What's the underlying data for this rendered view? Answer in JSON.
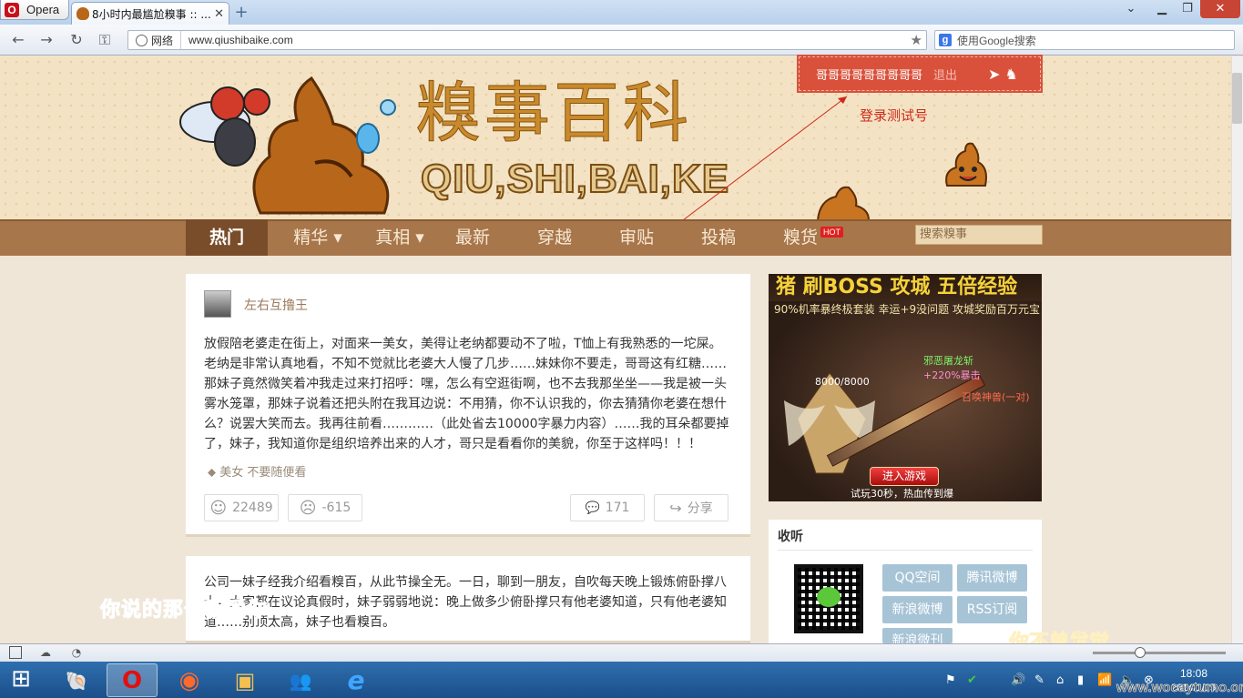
{
  "browser": {
    "menu_label": "Opera",
    "tab_title": "8小时内最尴尬糗事 :: ...",
    "tab_close": "✕",
    "new_tab": "+",
    "window_controls": {
      "minimize": "▁",
      "maximize": "❐",
      "close": "✕",
      "tabs_menu": "⌄"
    },
    "nav": {
      "back": "←",
      "forward": "→",
      "reload": "↻",
      "key": "⚿"
    },
    "address_zone": "网络",
    "url": "www.qiushibaike.com",
    "bookmark_star": "★",
    "search_placeholder": "使用Google搜索",
    "search_engine": "g"
  },
  "site": {
    "title_cn": "糗事百科",
    "title_en": "QIU,SHI,BAI,KE",
    "username": "哥哥哥哥哥哥哥哥哥",
    "logout": "退出",
    "user_arrows": "➤ ♞",
    "annotation": "登录测试号",
    "nav": [
      {
        "label": "热门",
        "active": true
      },
      {
        "label": "精华 ▾",
        "active": false
      },
      {
        "label": "真相 ▾",
        "active": false
      },
      {
        "label": "最新",
        "active": false
      },
      {
        "label": "穿越",
        "active": false
      },
      {
        "label": "审贴",
        "active": false
      },
      {
        "label": "投稿",
        "active": false
      },
      {
        "label": "糗货",
        "active": false
      }
    ],
    "hot_badge": "HOT",
    "search_placeholder": "搜索糗事"
  },
  "posts": [
    {
      "author": "左右互撸王",
      "text": "放假陪老婆走在街上，对面来一美女，美得让老纳都要动不了啦，T恤上有我熟悉的一坨屎。老纳是非常认真地看，不知不觉就比老婆大人慢了几步……妹妹你不要走，哥哥这有红糖……那妹子竟然微笑着冲我走过来打招呼：嘿，怎么有空逛街啊，也不去我那坐坐——我是被一头雾水笼罩，那妹子说着还把头附在我耳边说：不用猜，你不认识我的，你去猜猜你老婆在想什么？说罢大笑而去。我再往前看…………（此处省去10000字暴力内容）……我的耳朵都要掉了，妹子，我知道你是组织培养出来的人才，哥只是看看你的美貌，你至于这样吗！！！",
      "tag_icon": "⬥",
      "tags": "美女  不要随便看",
      "up_icon": "☺",
      "up": "22489",
      "down_icon": "☹",
      "down": "-615",
      "comment_icon": "💬",
      "comments": "171",
      "share_icon": "↪",
      "share": "分享"
    },
    {
      "text": "公司一妹子经我介绍看糗百，从此节操全无。一日，聊到一朋友，自吹每天晚上锻炼俯卧撑八十，大家都在议论真假时，妹子弱弱地说：晚上做多少俯卧撑只有他老婆知道，只有他老婆知道……别顶太高，妹子也看糗百。"
    }
  ],
  "ad": {
    "headline": "猪 刷BOSS 攻城 五倍经验",
    "sub": "90%机率暴终极套装 幸运+9没问题 攻城奖励百万元宝",
    "hp": "8000/8000",
    "skill1": "邪恶屠龙斩",
    "skill2": "+220%暴击",
    "skill3": "召唤神兽(一对)",
    "button": "进入游戏",
    "footer": "试玩30秒，热血传到爆"
  },
  "follow": {
    "title": "收听",
    "buttons": [
      "QQ空间",
      "腾讯微博",
      "新浪微博",
      "RSS订阅",
      "新浪微刊"
    ]
  },
  "overlay": {
    "subtitle_left": "你说的那句我爱你",
    "subtitle_right": "你不曾发觉"
  },
  "taskbar": {
    "start": "⊞",
    "apps": [
      "🐚",
      "O",
      "◉",
      "▣",
      "👥",
      "e"
    ],
    "tray": [
      "⚑",
      "🔊",
      "✎",
      "⌂",
      "▮",
      "📶",
      "🔈",
      "⊗"
    ],
    "time": "18:08",
    "date": "2014/1/15",
    "watermark": "www.wocaytumo.org"
  },
  "colors": {
    "nav_bg": "#a8764b",
    "nav_active": "#7a4d2a",
    "user_box": "#d9513b",
    "social": "#a7c4d6",
    "accent_red": "#d0271a"
  }
}
